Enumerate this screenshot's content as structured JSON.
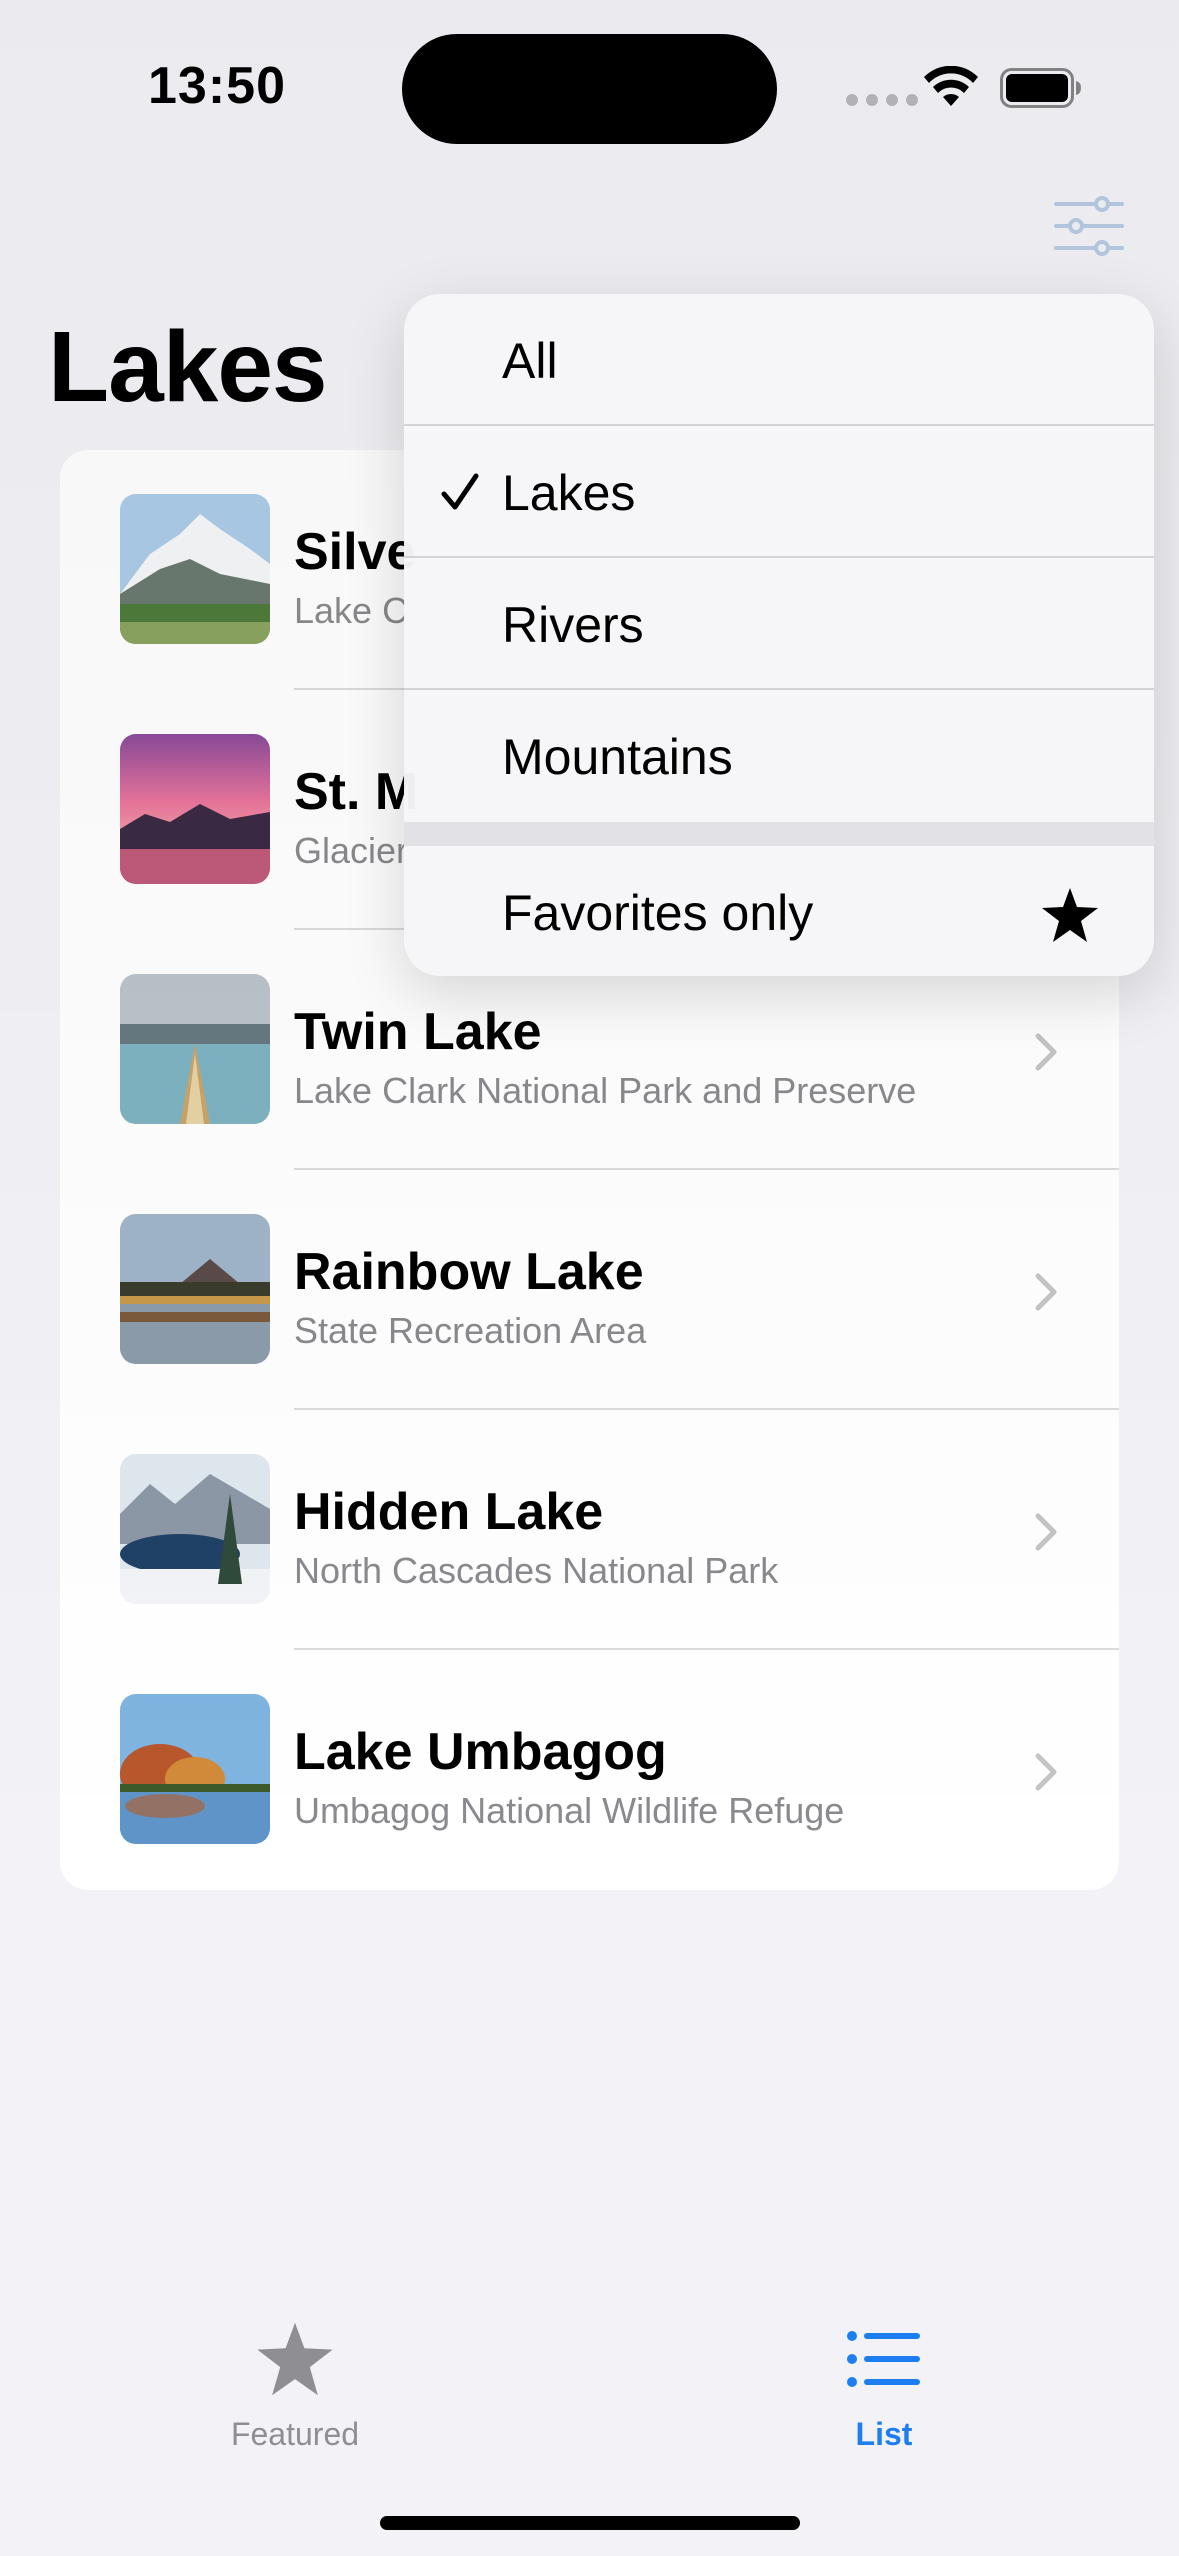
{
  "status_bar": {
    "time": "13:50"
  },
  "page": {
    "title": "Lakes"
  },
  "list": {
    "items": [
      {
        "title": "Silve",
        "subtitle": "Lake C",
        "thumb": "snowy-mountain-meadow"
      },
      {
        "title": "St. M",
        "subtitle": "Glacier",
        "thumb": "pink-sunset-lake"
      },
      {
        "title": "Twin Lake",
        "subtitle": "Lake Clark National Park and Preserve",
        "thumb": "kayak-bow-lake"
      },
      {
        "title": "Rainbow Lake",
        "subtitle": "State Recreation Area",
        "thumb": "forest-reflection"
      },
      {
        "title": "Hidden Lake",
        "subtitle": "North Cascades National Park",
        "thumb": "snowy-alpine-lake"
      },
      {
        "title": "Lake Umbagog",
        "subtitle": "Umbagog National Wildlife Refuge",
        "thumb": "autumn-lake"
      }
    ]
  },
  "filter_menu": {
    "options": [
      {
        "label": "All",
        "selected": false
      },
      {
        "label": "Lakes",
        "selected": true
      },
      {
        "label": "Rivers",
        "selected": false
      },
      {
        "label": "Mountains",
        "selected": false
      }
    ],
    "favorites": {
      "label": "Favorites only",
      "icon": "star-icon"
    }
  },
  "tab_bar": {
    "tabs": [
      {
        "label": "Featured",
        "icon": "star-icon",
        "active": false
      },
      {
        "label": "List",
        "icon": "list-icon",
        "active": true
      }
    ]
  },
  "colors": {
    "accent": "#1c7ef0",
    "inactive_tab": "#8e8e93",
    "background": "#f2f2f7"
  }
}
